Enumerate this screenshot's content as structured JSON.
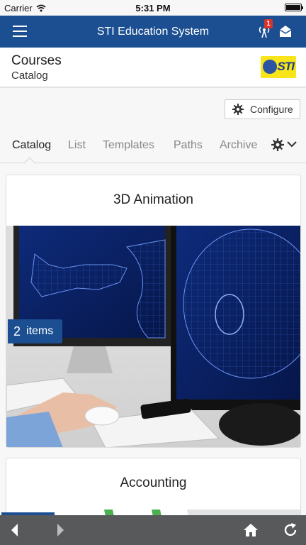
{
  "status_bar": {
    "carrier": "Carrier",
    "time": "5:31 PM"
  },
  "nav": {
    "title": "STI Education System",
    "notification_count": "1",
    "menu_icon": "hamburger-icon",
    "antenna_icon": "antenna-icon",
    "mail_icon": "envelope-icon"
  },
  "header": {
    "title": "Courses",
    "subtitle": "Catalog",
    "logo_text": "STI"
  },
  "configure_label": "Configure",
  "tabs": [
    {
      "label": "Catalog",
      "active": true
    },
    {
      "label": "List"
    },
    {
      "label": "Templates"
    },
    {
      "label": "Paths"
    },
    {
      "label": "Archive"
    }
  ],
  "courses": [
    {
      "title": "3D Animation",
      "count": "2",
      "count_label": "items"
    },
    {
      "title": "Accounting"
    }
  ],
  "toolbar": {
    "back_icon": "back-arrow-icon",
    "forward_icon": "forward-arrow-icon",
    "home_icon": "home-icon",
    "refresh_icon": "refresh-icon"
  },
  "colors": {
    "brand": "#1b4f92",
    "badge": "#d9322c",
    "logo_bg": "#f7e51a",
    "toolbar": "#58595b"
  }
}
